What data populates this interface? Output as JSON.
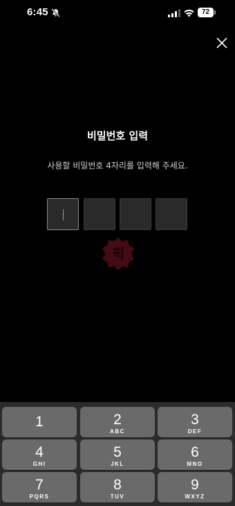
{
  "status_bar": {
    "time": "6:45",
    "battery": "72",
    "icons": [
      "bell-off-icon",
      "signal-icon",
      "wifi-icon",
      "battery-icon"
    ]
  },
  "header": {
    "close_icon": "close-icon"
  },
  "pin": {
    "title": "비밀번호 입력",
    "subtitle": "사용할 비밀번호 4자리를 입력해 주세요.",
    "length": 4,
    "entered": 0
  },
  "watermark": {
    "text": "픽"
  },
  "keypad": {
    "keys": [
      {
        "digit": "1",
        "letters": ""
      },
      {
        "digit": "2",
        "letters": "ABC"
      },
      {
        "digit": "3",
        "letters": "DEF"
      },
      {
        "digit": "4",
        "letters": "GHI"
      },
      {
        "digit": "5",
        "letters": "JKL"
      },
      {
        "digit": "6",
        "letters": "MNO"
      },
      {
        "digit": "7",
        "letters": "PQRS"
      },
      {
        "digit": "8",
        "letters": "TUV"
      },
      {
        "digit": "9",
        "letters": "WXYZ"
      }
    ]
  },
  "colors": {
    "background": "#000000",
    "keypad_bg": "#2b2b2b",
    "key_bg": "#6a6a6a",
    "pin_box": "#2a2a2a",
    "watermark": "#7a1424"
  }
}
